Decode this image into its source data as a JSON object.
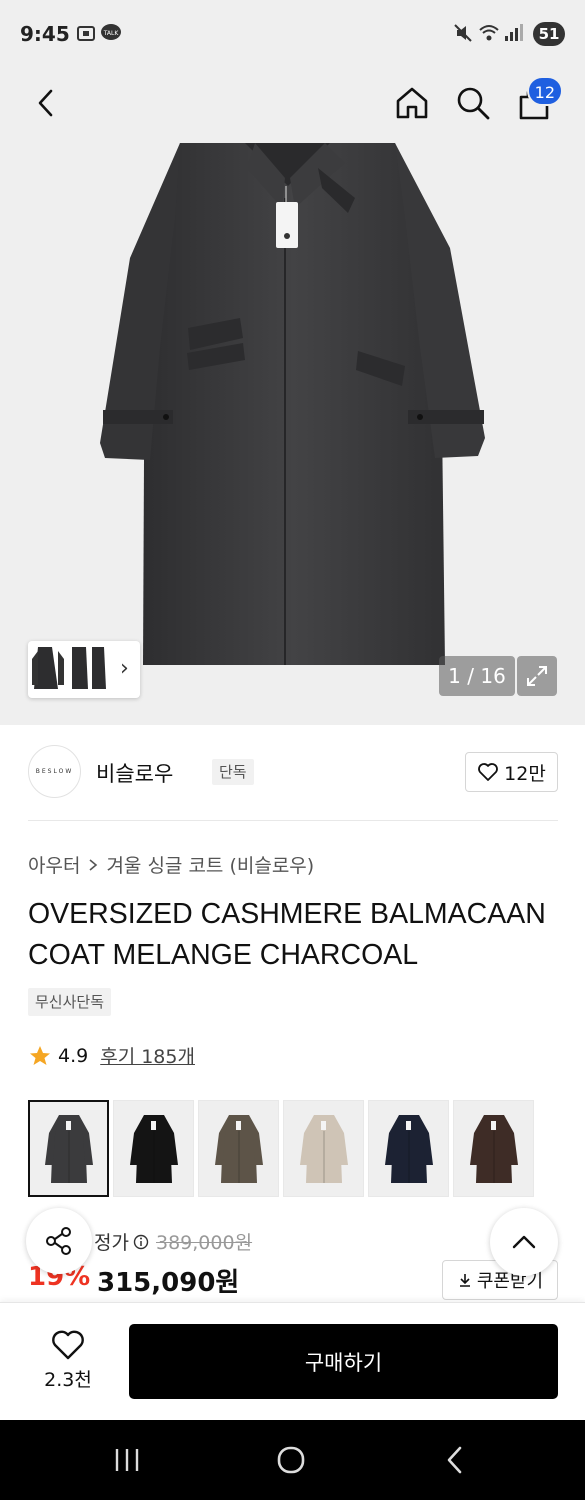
{
  "status_bar": {
    "time": "9:45",
    "notification_icons": [
      "screenshot-icon",
      "kakaotalk-icon"
    ],
    "kakao_label": "TALK",
    "system_icons": [
      "mute-icon",
      "wifi-icon",
      "signal-icon"
    ],
    "battery_level": "51"
  },
  "nav": {
    "icons": [
      "back-icon",
      "home-icon",
      "search-icon",
      "cart-icon"
    ],
    "cart_count": "12"
  },
  "gallery": {
    "counter": "1 / 16",
    "thumbnail_chevron": "›"
  },
  "brand": {
    "logo_text": "BESLOW",
    "name": "비슬로우",
    "tag": "단독",
    "like_count": "12만"
  },
  "product": {
    "breadcrumb": [
      "아우터",
      "겨울 싱글 코트 (비슬로우)"
    ],
    "title": "OVERSIZED CASHMERE BALMACAAN COAT MELANGE CHARCOAL",
    "exclusive_tag": "무신사단독",
    "rating": "4.9",
    "review_link": "후기 185개"
  },
  "colors": {
    "swatches": [
      "#3b3b3d",
      "#141414",
      "#5d5448",
      "#cfc4b6",
      "#1c2233",
      "#3e2c26"
    ],
    "selected_index": 0
  },
  "price": {
    "label": "정가",
    "original": "389,000원",
    "discount": "19%",
    "sale": "315,090원",
    "coupon_label": "쿠폰받기"
  },
  "bottom_bar": {
    "wish_count": "2.3천",
    "buy_label": "구매하기"
  },
  "colors_ui": {
    "accent_blue": "#1f5fe0",
    "discount_red": "#ee3322",
    "star": "#f5a623"
  }
}
